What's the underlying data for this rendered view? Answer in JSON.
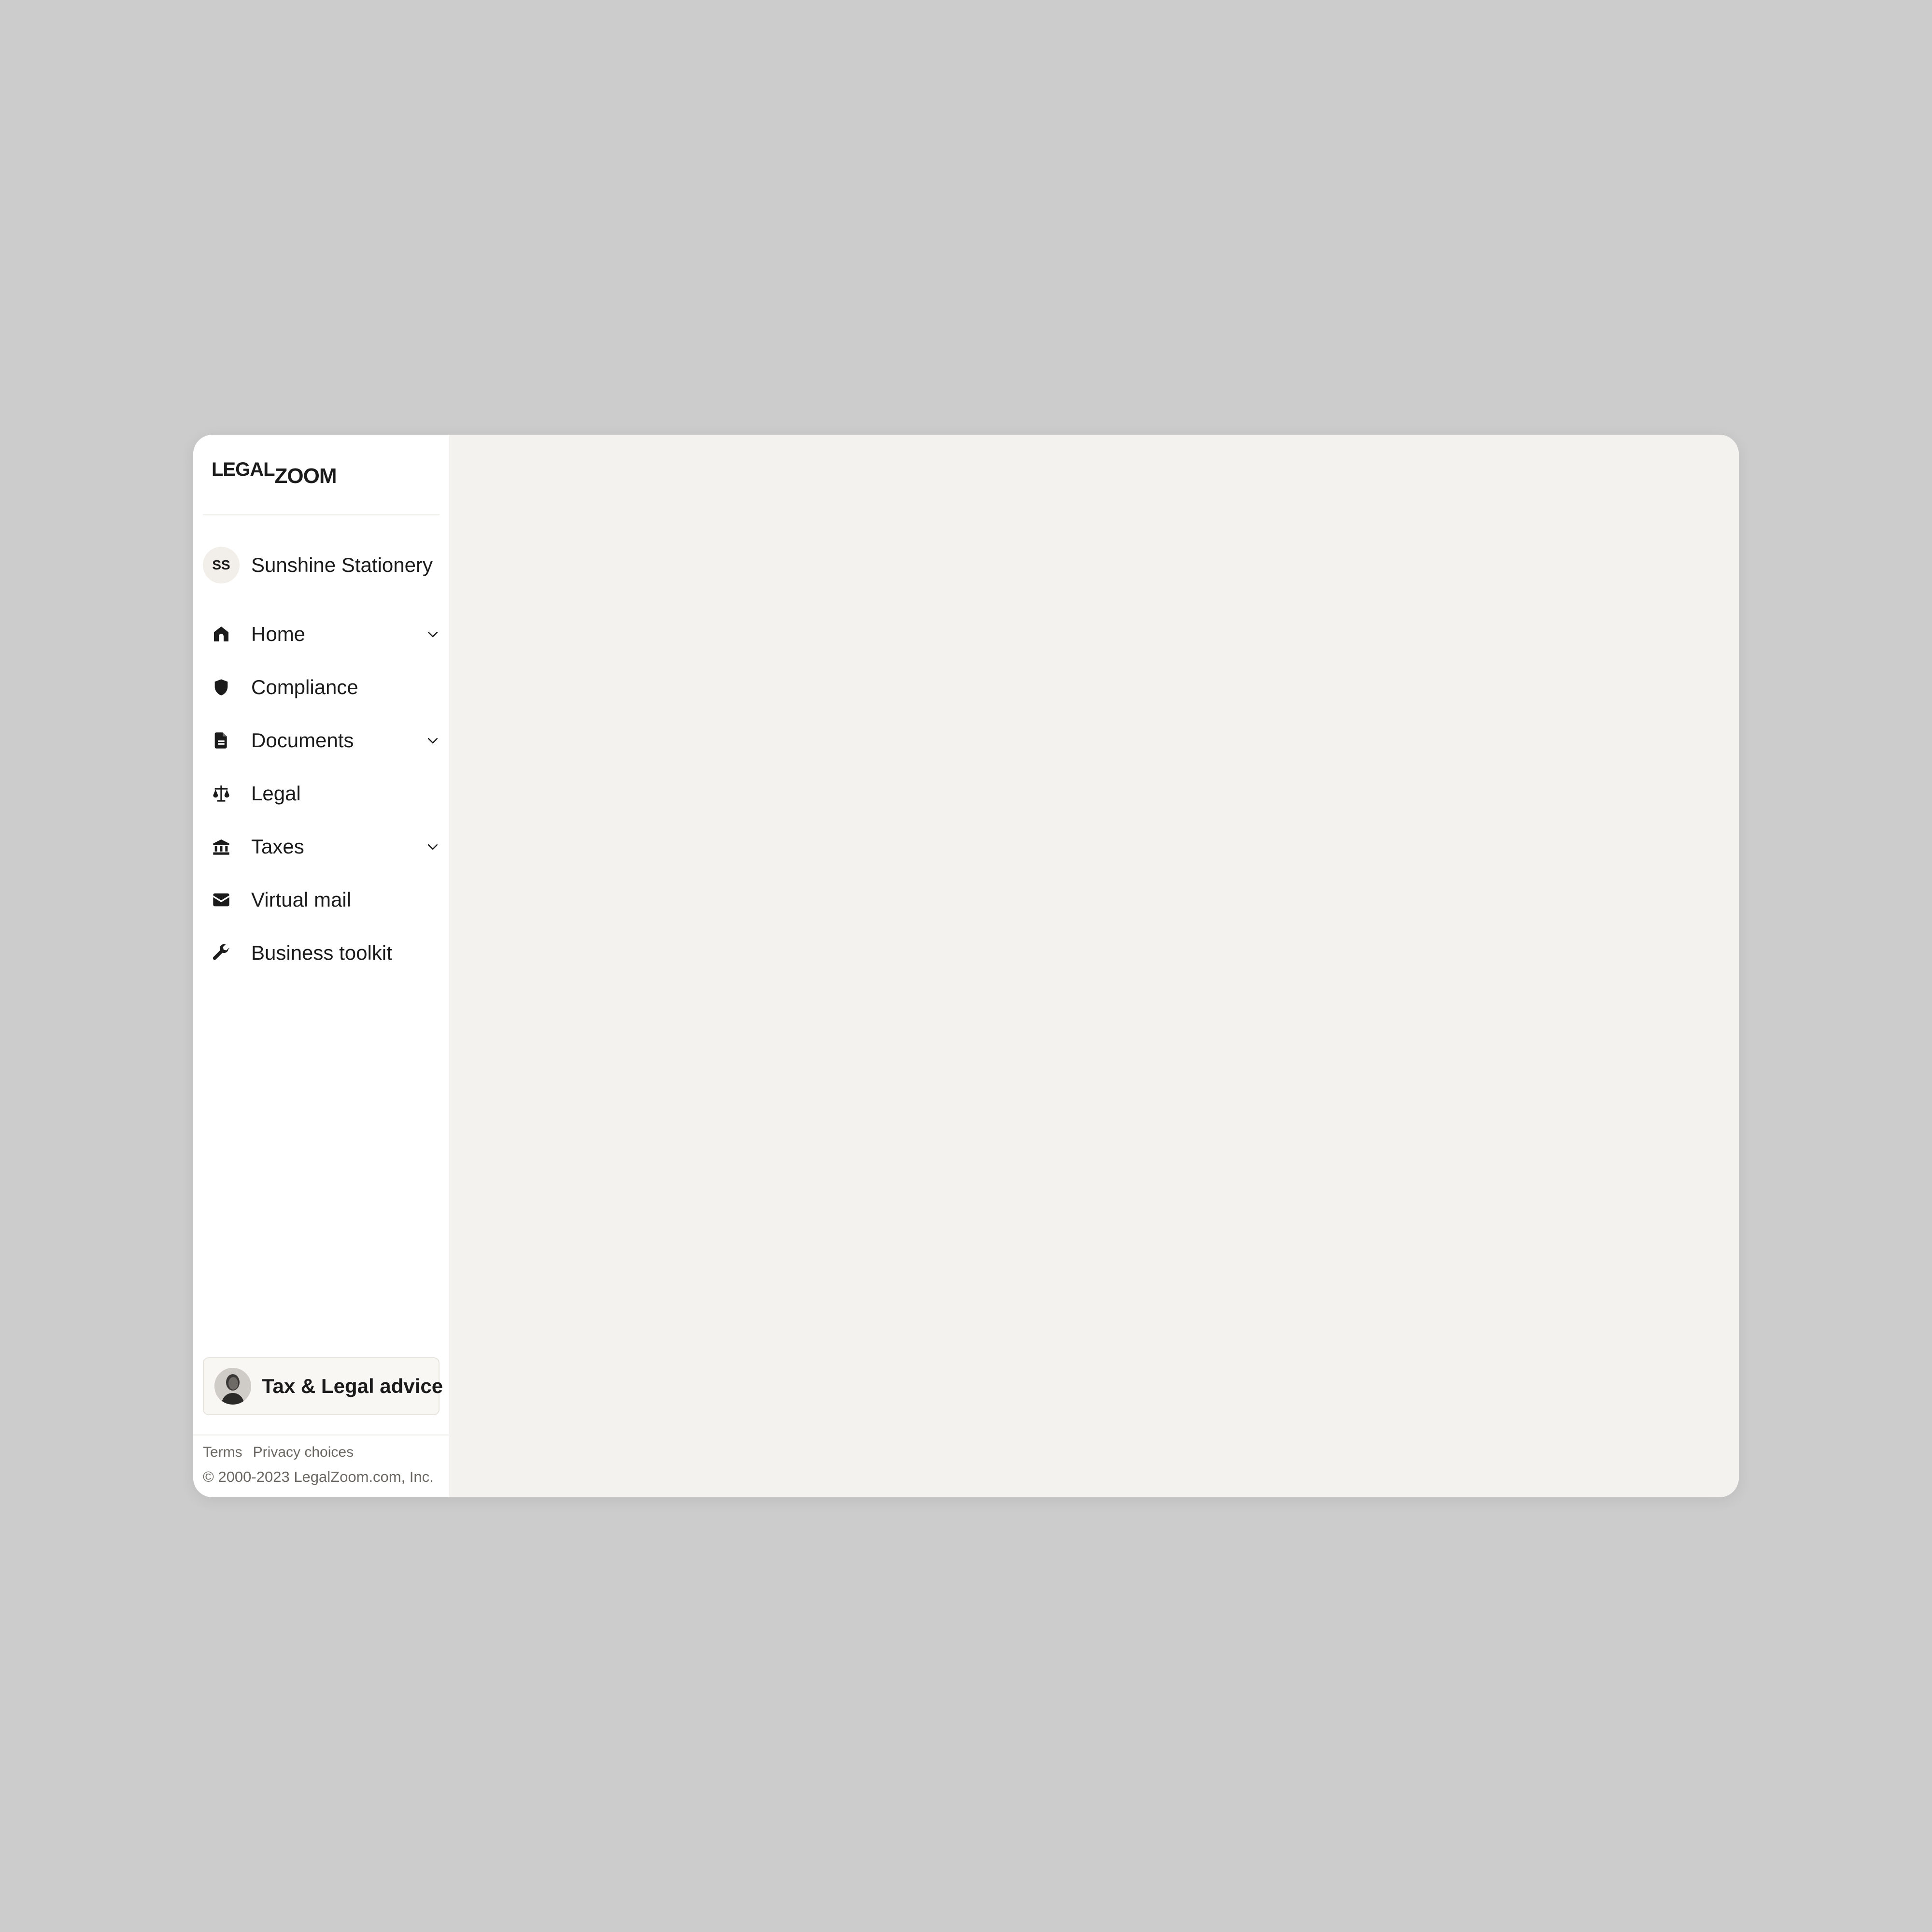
{
  "brand": {
    "logo_part1": "LEGAL",
    "logo_part2": "ZOOM"
  },
  "business": {
    "initials": "SS",
    "name": "Sunshine Stationery"
  },
  "nav": {
    "items": [
      {
        "label": "Home",
        "icon": "home-icon",
        "has_submenu": true
      },
      {
        "label": "Compliance",
        "icon": "shield-icon",
        "has_submenu": false
      },
      {
        "label": "Documents",
        "icon": "document-icon",
        "has_submenu": true
      },
      {
        "label": "Legal",
        "icon": "scale-icon",
        "has_submenu": false
      },
      {
        "label": "Taxes",
        "icon": "bank-icon",
        "has_submenu": true
      },
      {
        "label": "Virtual mail",
        "icon": "envelope-icon",
        "has_submenu": false
      },
      {
        "label": "Business toolkit",
        "icon": "wrench-icon",
        "has_submenu": false
      }
    ]
  },
  "advice": {
    "label": "Tax & Legal advice"
  },
  "footer": {
    "terms": "Terms",
    "privacy": "Privacy choices",
    "copyright": "© 2000-2023 LegalZoom.com, Inc."
  },
  "colors": {
    "page_background": "#cccccc",
    "sidebar_background": "#ffffff",
    "main_background": "#f4f2ee",
    "text_primary": "#1b1b1b",
    "text_muted": "#6b6864"
  }
}
